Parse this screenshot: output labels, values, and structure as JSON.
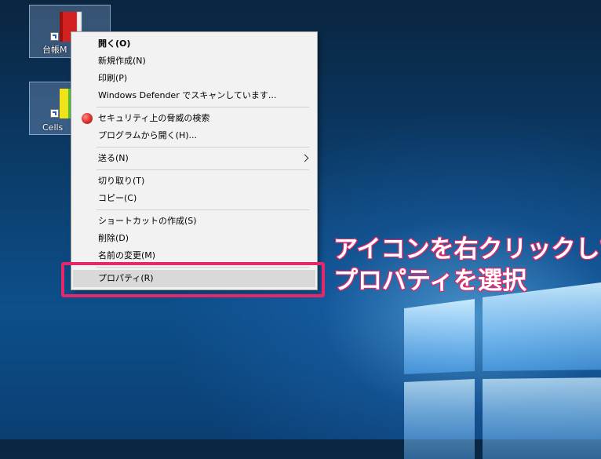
{
  "desktop": {
    "icons": [
      {
        "label": "台帳M",
        "icon": "book-red-icon"
      },
      {
        "label": "Cells",
        "icon": "book-yellow-green-icon"
      }
    ]
  },
  "context_menu": {
    "items": [
      {
        "label": "開く(O)",
        "bold": true
      },
      {
        "label": "新規作成(N)"
      },
      {
        "label": "印刷(P)"
      },
      {
        "label": "Windows Defender でスキャンしています..."
      },
      {
        "label": "セキュリティ上の脅威の検索",
        "icon": "security-shield-icon"
      },
      {
        "label": "プログラムから開く(H)..."
      },
      {
        "label": "送る(N)",
        "submenu": true
      },
      {
        "label": "切り取り(T)"
      },
      {
        "label": "コピー(C)"
      },
      {
        "label": "ショートカットの作成(S)"
      },
      {
        "label": "削除(D)"
      },
      {
        "label": "名前の変更(M)"
      },
      {
        "label": "プロパティ(R)",
        "highlighted": true
      }
    ]
  },
  "annotation": {
    "line1": "アイコンを右クリックして",
    "line2": "プロパティを選択",
    "color": "#e8266a"
  }
}
